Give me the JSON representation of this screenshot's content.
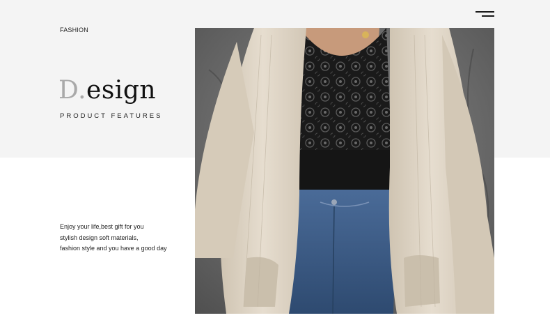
{
  "header": {
    "menu_icon": "hamburger-menu-icon"
  },
  "intro": {
    "category": "FASHION",
    "title_initial": "D.",
    "title_rest": "esign",
    "subtitle": "PRODUCT FEATURES"
  },
  "description": {
    "lines": [
      "Enjoy your life,best gift for you",
      "stylish design soft materials,",
      "fashion style and you have a good day"
    ]
  },
  "colors": {
    "top_band": "#f4f4f4",
    "title_initial": "#a9a9a9",
    "cardigan": "#ddd3c3",
    "top": "#1c1c1c",
    "denim": "#3a5a86"
  }
}
